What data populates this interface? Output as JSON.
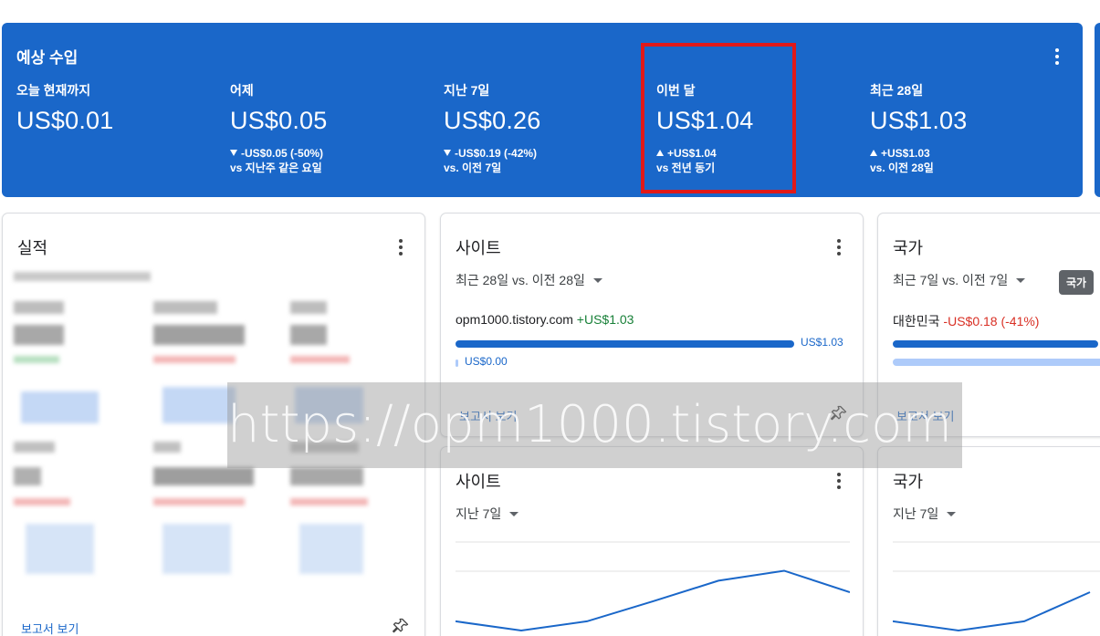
{
  "earnings": {
    "title": "예상 수입",
    "metrics": [
      {
        "label": "오늘 현재까지",
        "value": "US$0.01",
        "delta": "",
        "comparison": ""
      },
      {
        "label": "어제",
        "value": "US$0.05",
        "delta": "-US$0.05 (-50%)",
        "delta_direction": "down",
        "comparison": "vs 지난주 같은 요일"
      },
      {
        "label": "지난 7일",
        "value": "US$0.26",
        "delta": "-US$0.19 (-42%)",
        "delta_direction": "down",
        "comparison": "vs. 이전 7일"
      },
      {
        "label": "이번 달",
        "value": "US$1.04",
        "delta": "+US$1.04",
        "delta_direction": "up",
        "comparison": "vs 전년 동기"
      },
      {
        "label": "최근 28일",
        "value": "US$1.03",
        "delta": "+US$1.03",
        "delta_direction": "up",
        "comparison": "vs. 이전 28일"
      }
    ],
    "highlight_color": "#e11919"
  },
  "performance": {
    "title": "실적",
    "report_link": "보고서 보기"
  },
  "sites_top": {
    "title": "사이트",
    "period": "최근 28일 vs. 이전 28일",
    "site_name": "opm1000.tistory.com",
    "site_delta": "+US$1.03",
    "current_value": "US$1.03",
    "previous_value": "US$0.00",
    "current_fraction": 1.0,
    "report_link": "보고서 보기"
  },
  "countries_top": {
    "title": "국가",
    "period": "최근 7일 vs. 이전 7일",
    "country_name": "대한민국",
    "country_delta": "-US$0.18 (-41%)",
    "report_link": "보고서 보기",
    "tooltip": "국가"
  },
  "sites_bottom": {
    "title": "사이트",
    "period": "지난 7일",
    "trend": [
      0.12,
      0.0,
      0.12,
      0.38,
      0.65,
      0.78,
      0.5
    ]
  },
  "countries_bottom": {
    "title": "국가",
    "period": "지난 7일",
    "trend": [
      0.12,
      0.0,
      0.12,
      0.5
    ]
  },
  "watermark": {
    "text": "https://opm1000.tistory.com"
  },
  "colors": {
    "brand_blue": "#1a67c9",
    "light_blue": "#aecbfa",
    "positive": "#188038",
    "negative": "#d93025"
  }
}
